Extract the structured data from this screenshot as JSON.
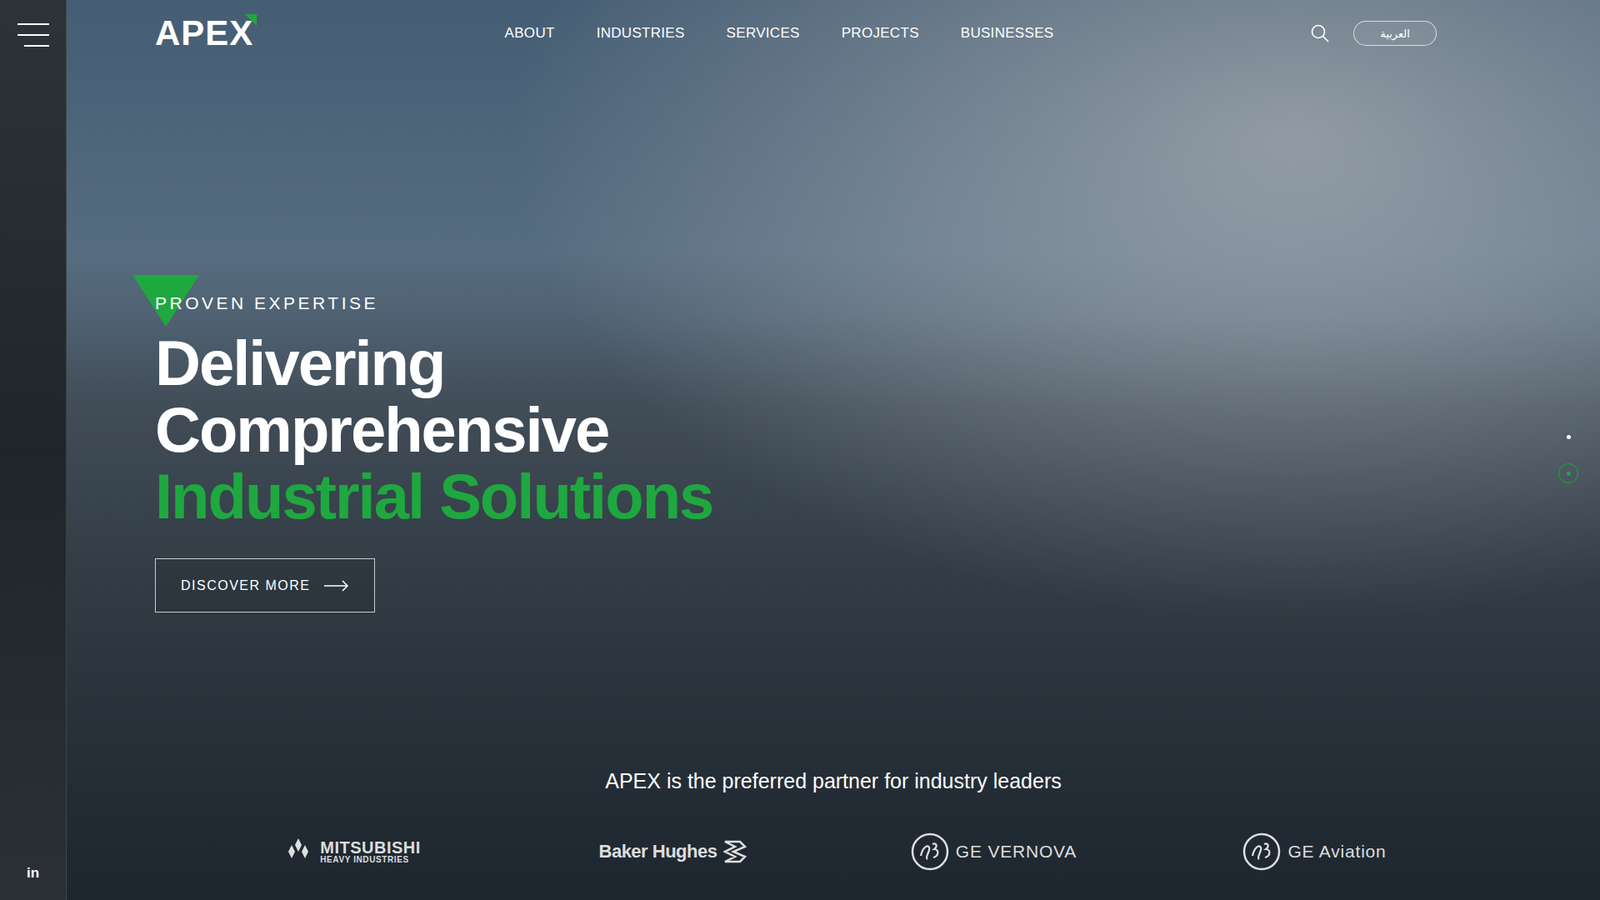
{
  "header": {
    "logo": "APEX",
    "nav": [
      {
        "label": "ABOUT"
      },
      {
        "label": "INDUSTRIES"
      },
      {
        "label": "SERVICES"
      },
      {
        "label": "PROJECTS"
      },
      {
        "label": "BUSINESSES"
      }
    ],
    "language_button": "العربية"
  },
  "sidebar": {
    "social": "in"
  },
  "hero": {
    "eyebrow": "PROVEN EXPERTISE",
    "title_lines": [
      {
        "text": "Delivering",
        "highlight": false
      },
      {
        "text": "Comprehensive",
        "highlight": false
      },
      {
        "text": "Industrial Solutions",
        "highlight": true
      }
    ],
    "button": "DISCOVER MORE"
  },
  "slider": {
    "dots": [
      {
        "selected": false
      },
      {
        "selected": true
      }
    ]
  },
  "partners": {
    "heading": "APEX is the preferred partner for industry leaders",
    "logos": [
      {
        "name": "MITSUBISHI",
        "sub": "HEAVY INDUSTRIES",
        "kind": "mitsubishi"
      },
      {
        "name": "Baker Hughes",
        "sub": "",
        "kind": "bakerhughes"
      },
      {
        "name": "GE VERNOVA",
        "sub": "",
        "kind": "ge"
      },
      {
        "name": "GE Aviation",
        "sub": "",
        "kind": "ge"
      }
    ]
  }
}
